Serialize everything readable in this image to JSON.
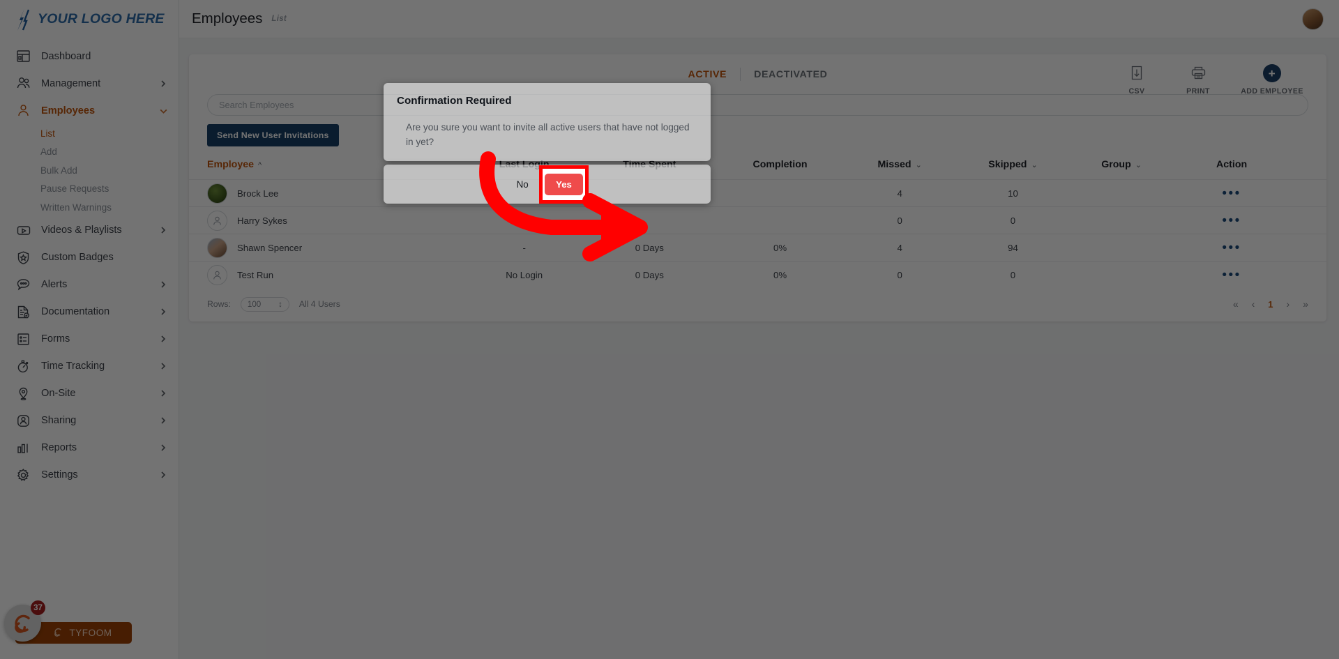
{
  "brand": {
    "logo_text": "YOUR LOGO HERE",
    "logo_color": "#2d6ca8",
    "accent_color": "#c0560d",
    "primary_color": "#173e66"
  },
  "sidebar": {
    "items": [
      {
        "label": "Dashboard",
        "icon": "dashboard-icon",
        "expandable": false
      },
      {
        "label": "Management",
        "icon": "people-icon",
        "expandable": true
      },
      {
        "label": "Employees",
        "icon": "person-icon",
        "expandable": true,
        "active": true
      },
      {
        "label": "Videos & Playlists",
        "icon": "video-icon",
        "expandable": true
      },
      {
        "label": "Custom Badges",
        "icon": "badge-shield-icon",
        "expandable": false
      },
      {
        "label": "Alerts",
        "icon": "chat-alert-icon",
        "expandable": true
      },
      {
        "label": "Documentation",
        "icon": "document-check-icon",
        "expandable": true
      },
      {
        "label": "Forms",
        "icon": "forms-list-icon",
        "expandable": true
      },
      {
        "label": "Time Tracking",
        "icon": "stopwatch-icon",
        "expandable": true
      },
      {
        "label": "On-Site",
        "icon": "location-pin-icon",
        "expandable": true
      },
      {
        "label": "Sharing",
        "icon": "share-person-icon",
        "expandable": true
      },
      {
        "label": "Reports",
        "icon": "bar-chart-icon",
        "expandable": true
      },
      {
        "label": "Settings",
        "icon": "gear-icon",
        "expandable": true
      }
    ],
    "employees_subitems": [
      {
        "label": "List",
        "active": true
      },
      {
        "label": "Add",
        "active": false
      },
      {
        "label": "Bulk Add",
        "active": false
      },
      {
        "label": "Pause Requests",
        "active": false
      },
      {
        "label": "Written Warnings",
        "active": false
      }
    ],
    "tyfoom": {
      "label": "TYFOOM",
      "badge_count": "37"
    }
  },
  "header": {
    "title": "Employees",
    "subtitle": "List"
  },
  "tabs": [
    {
      "label": "ACTIVE",
      "active": true
    },
    {
      "label": "DEACTIVATED",
      "active": false
    }
  ],
  "toolbar": [
    {
      "label": "CSV",
      "icon": "download-csv-icon"
    },
    {
      "label": "PRINT",
      "icon": "printer-icon"
    },
    {
      "label": "ADD EMPLOYEE",
      "icon": "plus-circle-icon"
    }
  ],
  "search": {
    "placeholder": "Search Employees",
    "value": ""
  },
  "invite_button_label": "Send New User Invitations",
  "table": {
    "columns": [
      {
        "label": "Employee",
        "sortable": true,
        "sorted": true,
        "sort_dir": "asc",
        "align": "left"
      },
      {
        "label": "Last Login",
        "sortable": false,
        "hidden_by_modal": true,
        "align": "center"
      },
      {
        "label": "Time Spent",
        "sortable": false,
        "hidden_by_modal": true,
        "align": "center"
      },
      {
        "label": "Completion",
        "sortable": false,
        "hidden_by_modal": true,
        "align": "center"
      },
      {
        "label": "Missed",
        "sortable": true,
        "align": "center"
      },
      {
        "label": "Skipped",
        "sortable": true,
        "align": "center"
      },
      {
        "label": "Group",
        "sortable": true,
        "align": "center"
      },
      {
        "label": "Action",
        "sortable": false,
        "align": "center"
      }
    ],
    "rows": [
      {
        "name": "Brock Lee",
        "avatar": "photo-green",
        "last_login": "",
        "time_spent": "",
        "completion": "",
        "missed": "4",
        "skipped": "10",
        "group": "",
        "action": "•••"
      },
      {
        "name": "Harry Sykes",
        "avatar": "placeholder",
        "last_login": "",
        "time_spent": "",
        "completion": "",
        "missed": "0",
        "skipped": "0",
        "group": "",
        "action": "•••"
      },
      {
        "name": "Shawn Spencer",
        "avatar": "photo-couple",
        "last_login": "-",
        "time_spent": "0 Days",
        "completion": "0%",
        "missed": "4",
        "skipped": "94",
        "group": "",
        "action": "•••"
      },
      {
        "name": "Test Run",
        "avatar": "placeholder",
        "last_login": "No Login",
        "time_spent": "0 Days",
        "completion": "0%",
        "missed": "0",
        "skipped": "0",
        "group": "",
        "action": "•••"
      }
    ]
  },
  "footer": {
    "rows_label": "Rows:",
    "rows_value": "100",
    "count_label": "All 4 Users",
    "pagination": {
      "first": "«",
      "prev": "‹",
      "current_page": "1",
      "next": "›",
      "last": "»"
    }
  },
  "modal": {
    "title": "Confirmation Required",
    "message": "Are you sure you want to invite all active users that have not logged in yet?",
    "no_label": "No",
    "yes_label": "Yes",
    "yes_button_color": "#ef4b4b"
  },
  "annotation": {
    "highlight_color": "#ff0000",
    "target": "yes-button"
  }
}
